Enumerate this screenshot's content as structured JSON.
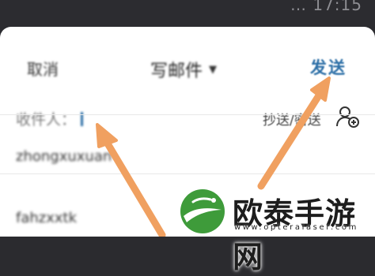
{
  "status_bar": {
    "right_text": "… 17:15"
  },
  "header": {
    "cancel_label": "取消",
    "title": "写邮件",
    "send_label": "发送"
  },
  "compose": {
    "recipient_label": "收件人：",
    "cc_bcc_label": "抄送/密送",
    "sender_value": "zhongxuxuan",
    "subject_value": "fahzxxtk"
  },
  "watermark": {
    "logo_text": "欧泰手游网",
    "logo_url": "www.opteralaser.com"
  },
  "colors": {
    "accent": "#2b6ea6",
    "annotation_arrow": "#f0a060",
    "logo_green": "#3e9b3a"
  },
  "icons": {
    "add_contact": "add-contact-icon",
    "dropdown": "chevron-down-icon"
  }
}
